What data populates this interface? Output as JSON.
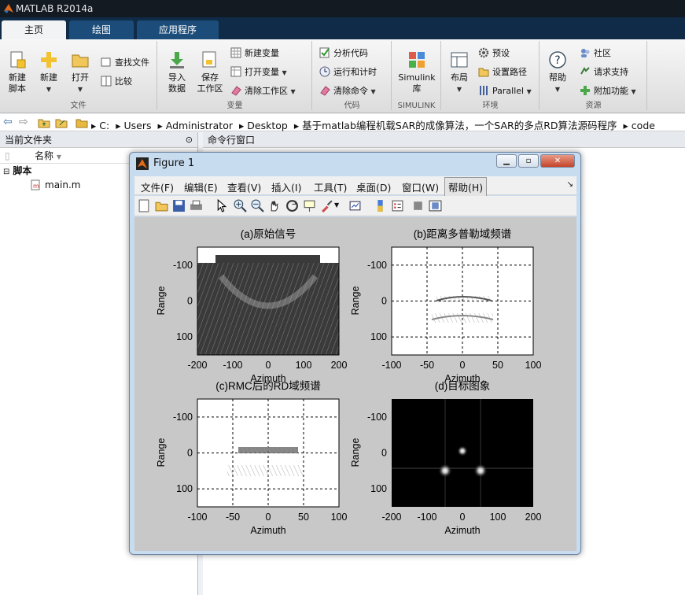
{
  "app": {
    "title": "MATLAB R2014a"
  },
  "tabs": [
    {
      "label": "主页"
    },
    {
      "label": "绘图"
    },
    {
      "label": "应用程序"
    }
  ],
  "ribbon": {
    "file": {
      "label": "文件",
      "new_script": "新建\n脚本",
      "new": "新建",
      "open": "打开",
      "find_files": "查找文件",
      "compare": "比较"
    },
    "variable": {
      "label": "变量",
      "import": "导入\n数据",
      "save_ws": "保存\n工作区",
      "new_var": "新建变量",
      "open_var": "打开变量",
      "clear_ws": "清除工作区"
    },
    "code": {
      "label": "代码",
      "analyze": "分析代码",
      "run_time": "运行和计时",
      "clear_cmd": "清除命令"
    },
    "simulink": {
      "label": "SIMULINK",
      "lib": "Simulink\n库"
    },
    "env": {
      "label": "环境",
      "layout": "布局",
      "prefs": "预设",
      "set_path": "设置路径",
      "parallel": "Parallel"
    },
    "res": {
      "label": "资源",
      "help": "帮助",
      "community": "社区",
      "support": "请求支持",
      "addons": "附加功能"
    }
  },
  "address": {
    "path": [
      "C:",
      "Users",
      "Administrator",
      "Desktop",
      "基于matlab编程机载SAR的成像算法，一个SAR的多点RD算法源码程序",
      "code"
    ]
  },
  "left_panel": {
    "title": "当前文件夹",
    "col_name": "名称",
    "folder": "脚本",
    "file": "main.m"
  },
  "command_window": {
    "title": "命令行窗口"
  },
  "figure": {
    "title": "Figure 1",
    "menus": [
      "文件(F)",
      "编辑(E)",
      "查看(V)",
      "插入(I)",
      "工具(T)",
      "桌面(D)",
      "窗口(W)",
      "帮助(H)"
    ],
    "plots": [
      {
        "title": "(a)原始信号",
        "xlabel": "Azimuth",
        "ylabel": "Range",
        "xticks": [
          "-200",
          "-100",
          "0",
          "100",
          "200"
        ],
        "yticks": [
          "-100",
          "0",
          "100"
        ],
        "grid": false
      },
      {
        "title": "(b)距离多普勒域频谱",
        "xlabel": "Azimuth",
        "ylabel": "Range",
        "xticks": [
          "-100",
          "-50",
          "0",
          "50",
          "100"
        ],
        "yticks": [
          "-100",
          "0",
          "100"
        ],
        "grid": true
      },
      {
        "title": "(c)RMC后的RD域频谱",
        "xlabel": "Azimuth",
        "ylabel": "Range",
        "xticks": [
          "-100",
          "-50",
          "0",
          "50",
          "100"
        ],
        "yticks": [
          "-100",
          "0",
          "100"
        ],
        "grid": true
      },
      {
        "title": "(d)目标图象",
        "xlabel": "Azimuth",
        "ylabel": "Range",
        "xticks": [
          "-200",
          "-100",
          "0",
          "100",
          "200"
        ],
        "yticks": [
          "-100",
          "0",
          "100"
        ],
        "grid": false
      }
    ]
  }
}
